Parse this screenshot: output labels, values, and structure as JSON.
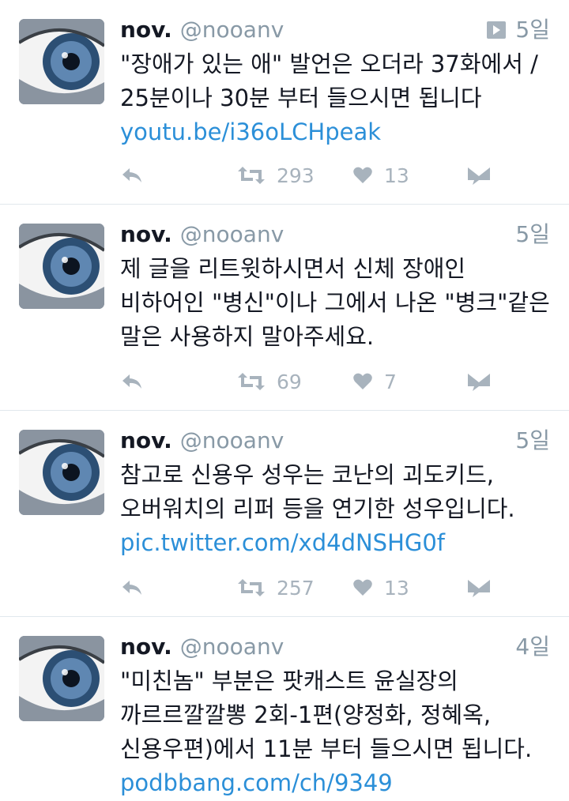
{
  "tweets": [
    {
      "name": "nov.",
      "handle": "@nooanv",
      "time": "5일",
      "has_media": true,
      "lines": [
        "\"장애가 있는 애\" 발언은 오더라 37화에서 /",
        "25분이나 30분 부터 들으시면 됩니다"
      ],
      "link": "youtu.be/i36oLCHpeak",
      "retweets": "293",
      "likes": "13"
    },
    {
      "name": "nov.",
      "handle": "@nooanv",
      "time": "5일",
      "has_media": false,
      "lines": [
        "제 글을 리트윗하시면서 신체 장애인",
        "비하어인 \"병신\"이나 그에서 나온 \"병크\"같은",
        "말은 사용하지 말아주세요."
      ],
      "link": "",
      "retweets": "69",
      "likes": "7"
    },
    {
      "name": "nov.",
      "handle": "@nooanv",
      "time": "5일",
      "has_media": false,
      "lines": [
        "참고로 신용우 성우는 코난의 괴도키드,",
        "오버워치의 리퍼 등을 연기한 성우입니다."
      ],
      "link": "pic.twitter.com/xd4dNSHG0f",
      "retweets": "257",
      "likes": "13"
    },
    {
      "name": "nov.",
      "handle": "@nooanv",
      "time": "4일",
      "has_media": false,
      "lines": [
        "\"미친놈\" 부분은 팟캐스트 윤실장의",
        "까르르깔깔뽕 2회-1편(양정화, 정혜옥,",
        "신용우편)에서 11분 부터 들으시면 됩니다."
      ],
      "link": "podbbang.com/ch/9349",
      "retweets": "",
      "likes": ""
    }
  ],
  "icons": [
    "reply-icon",
    "retweet-icon",
    "like-icon",
    "direct-message-icon",
    "video-play-icon"
  ],
  "colors": {
    "link": "#2b8fd8",
    "meta_gray": "#8899a6",
    "action_gray": "#a8b3bd",
    "divider": "#e1e8ed"
  }
}
